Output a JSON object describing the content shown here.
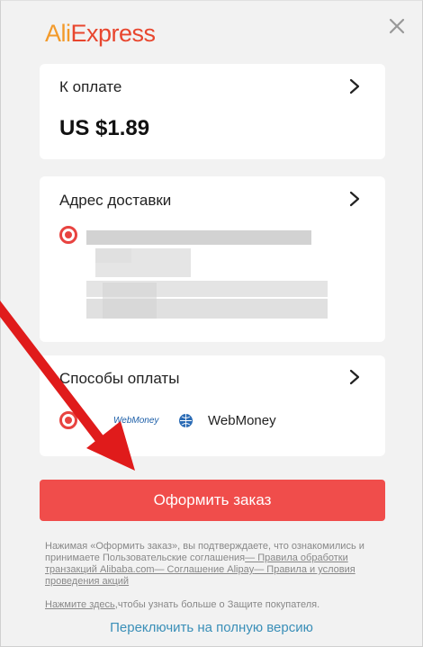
{
  "brand": {
    "part1": "Ali",
    "part2": "Express"
  },
  "payment_total": {
    "label": "К оплате",
    "amount": "US $1.89"
  },
  "shipping": {
    "label": "Адрес доставки"
  },
  "payment_methods": {
    "label": "Способы оплаты",
    "method_logo": "WebMoney",
    "method_name": "WebMoney"
  },
  "order_button": "Оформить заказ",
  "legal": {
    "text1": "Нажимая «Оформить заказ», вы подтверждаете, что ознакомились и принимаете Пользовательские соглашения",
    "link1": "— Правила обработки транзакций Alibaba.com",
    "link2": "— Соглашение Alipay",
    "link3": "— Правила и условия проведения акций"
  },
  "protection": {
    "link": "Нажмите здесь",
    "text": ",чтобы узнать больше о Защите покупателя."
  },
  "switch_version": "Переключить на полную версию",
  "colors": {
    "accent": "#f04d4b",
    "link": "#3a8fb8",
    "logo_orange": "#f39a2a",
    "logo_red": "#e8462e",
    "annotation_arrow": "#e01b1b"
  },
  "icons": [
    "close-icon",
    "chevron-right-icon",
    "radio-selected-icon",
    "webmoney-globe-icon",
    "annotation-arrow"
  ]
}
